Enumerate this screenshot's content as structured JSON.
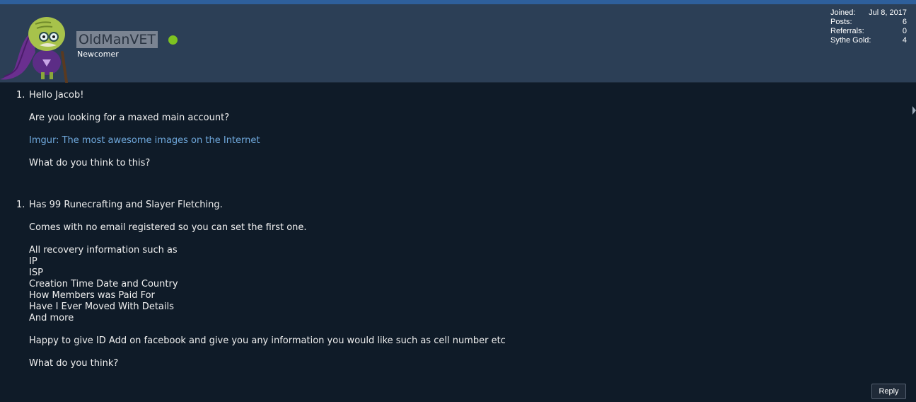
{
  "user": {
    "username": "OldManVET",
    "title": "Newcomer",
    "avatar_icon": "cartoon-old-man-avatar-icon",
    "online_status_color": "#7ec321"
  },
  "stats": {
    "joined_label": "Joined:",
    "joined_value": "Jul 8, 2017",
    "posts_label": "Posts:",
    "posts_value": "6",
    "referrals_label": "Referrals:",
    "referrals_value": "0",
    "gold_label": "Sythe Gold:",
    "gold_value": "4"
  },
  "post": {
    "list1_number": "1.",
    "greeting": "Hello Jacob!",
    "question": "Are you looking for a maxed main account?",
    "link_text": "Imgur: The most awesome images on the Internet",
    "followup": "What do you think to this?",
    "list2_number": "1.",
    "skills": "Has 99 Runecrafting and Slayer Fletching.",
    "email": "Comes with no email registered so you can set the first one.",
    "recovery_intro": "All recovery information such as",
    "recovery_items": [
      "IP",
      "ISP",
      "Creation Time Date and Country",
      "How Members was Paid For",
      "Have I Ever Moved With Details",
      "And more"
    ],
    "offer": "Happy to give ID Add on facebook and give you any information you would like such as cell number etc",
    "closing": "What do you think?"
  },
  "actions": {
    "reply_label": "Reply"
  },
  "colors": {
    "header_bg": "#2c3f56",
    "content_bg": "#0f1b28",
    "link": "#6fa8dc",
    "top_strip": "#2e5f9b"
  }
}
